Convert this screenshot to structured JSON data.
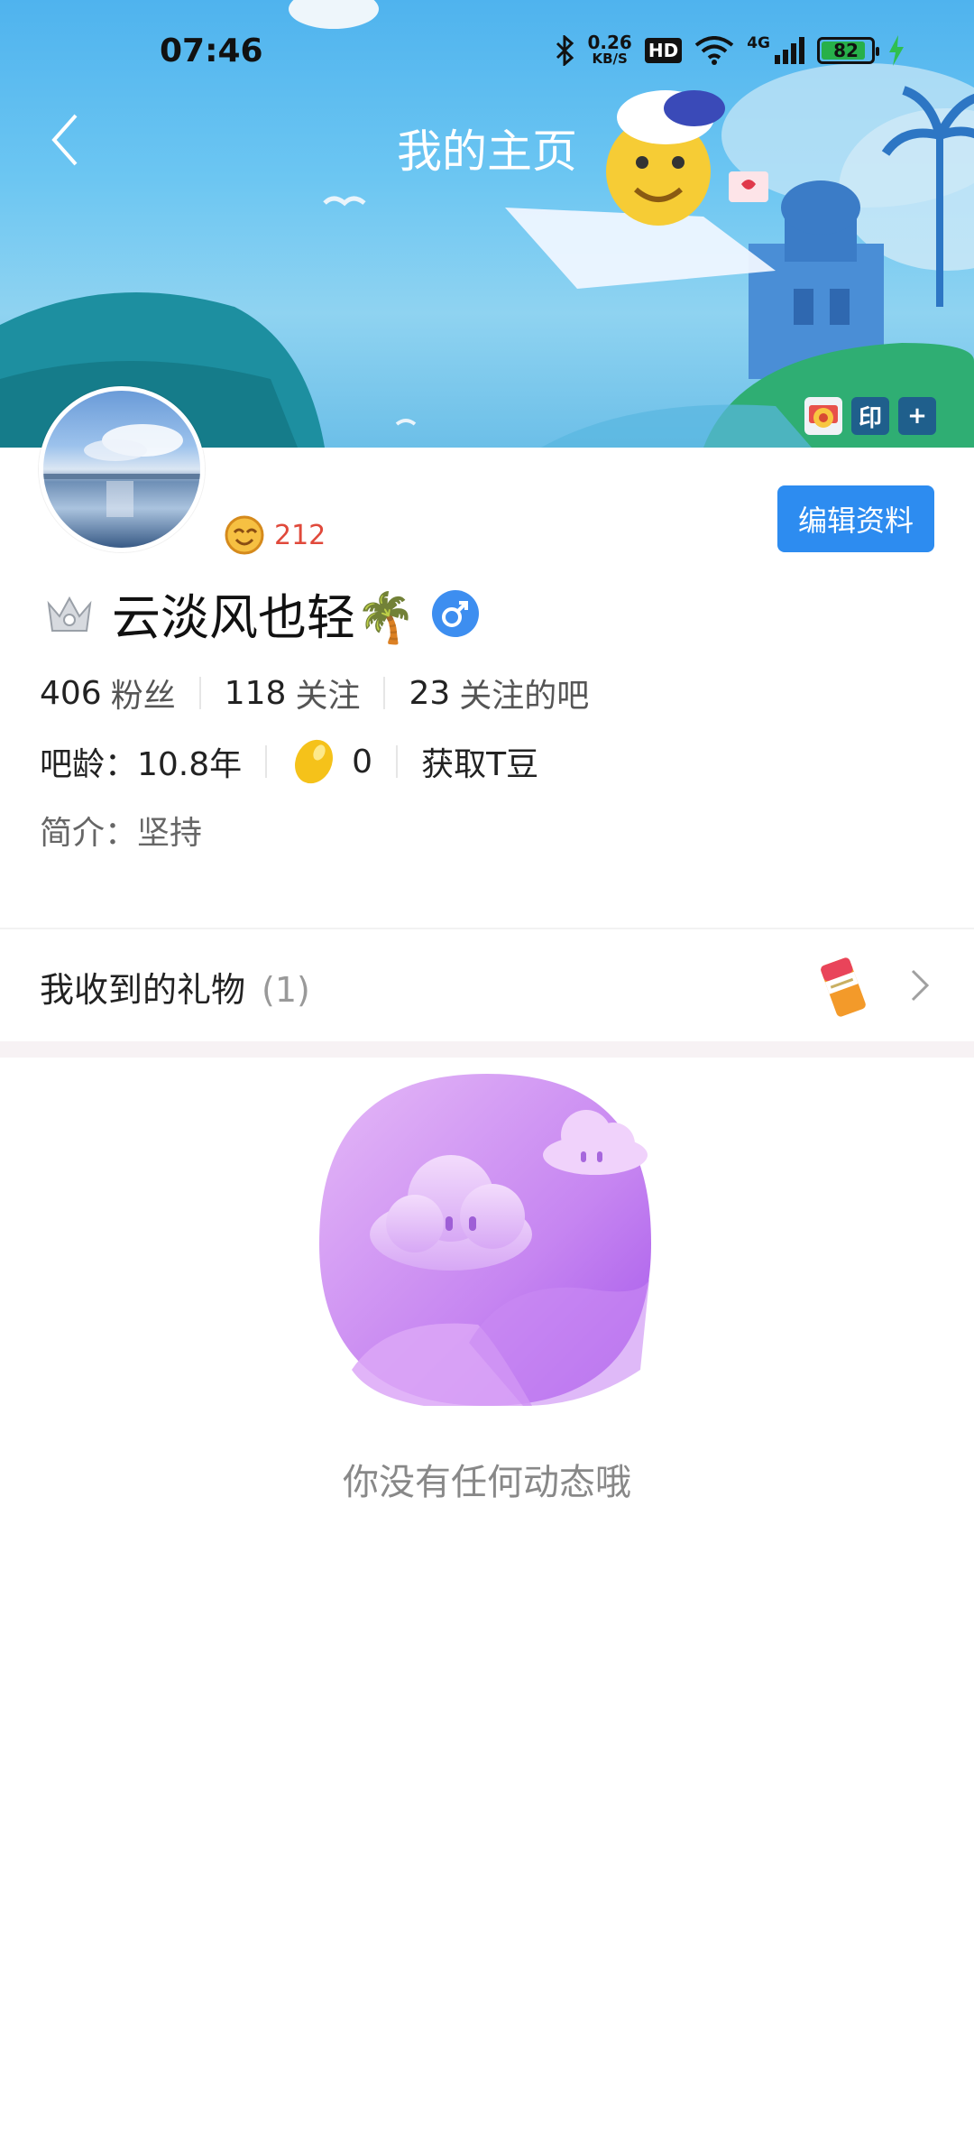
{
  "status_bar": {
    "time": "07:46",
    "net_speed_value": "0.26",
    "net_speed_unit": "KB/S",
    "hd": "HD",
    "cell": "4G",
    "battery": "82"
  },
  "header": {
    "title": "我的主页"
  },
  "header_badges": [
    "印",
    "+"
  ],
  "profile": {
    "level": "212",
    "edit_label": "编辑资料",
    "username": "云淡风也轻🌴",
    "stats": [
      {
        "value": "406",
        "label": "粉丝"
      },
      {
        "value": "118",
        "label": "关注"
      },
      {
        "value": "23",
        "label": "关注的吧"
      }
    ],
    "bar_age": "吧龄：10.8年",
    "tdou_count": "0",
    "get_tdou": "获取T豆",
    "bio": "简介：坚持"
  },
  "gifts": {
    "title": "我收到的礼物",
    "count": "(1)"
  },
  "empty_state": {
    "message": "你没有任何动态哦"
  },
  "colors": {
    "accent": "#2d8cf0",
    "level_red": "#e0493b",
    "empty_purple": "#c27cf2"
  }
}
